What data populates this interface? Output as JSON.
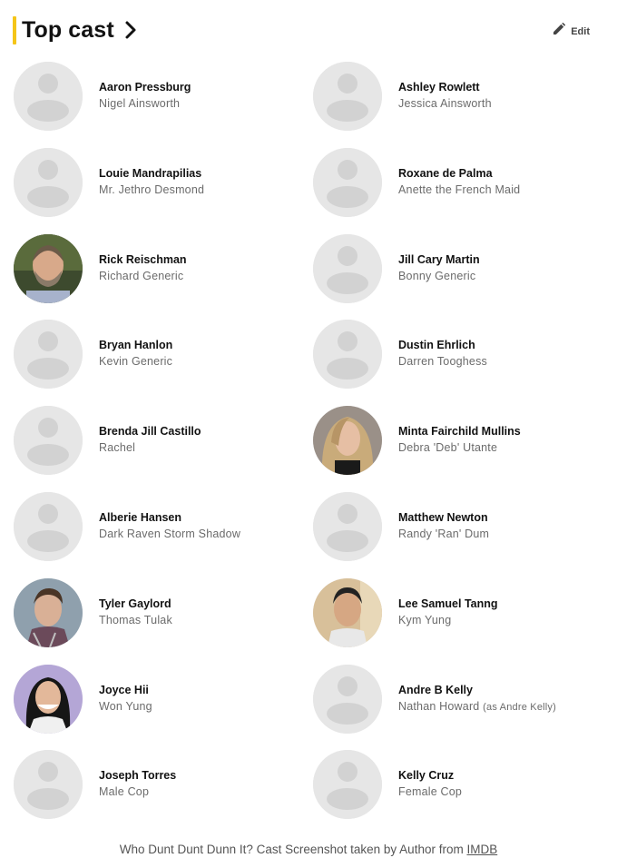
{
  "header": {
    "title": "Top cast",
    "edit_label": "Edit",
    "accent_color": "#f5c518"
  },
  "cast": [
    {
      "actor": "Aaron Pressburg",
      "role": "Nigel Ainsworth",
      "role_note": "",
      "photo": "placeholder"
    },
    {
      "actor": "Ashley Rowlett",
      "role": "Jessica Ainsworth",
      "role_note": "",
      "photo": "placeholder"
    },
    {
      "actor": "Louie Mandrapilias",
      "role": "Mr. Jethro Desmond",
      "role_note": "",
      "photo": "placeholder"
    },
    {
      "actor": "Roxane de Palma",
      "role": "Anette the French Maid",
      "role_note": "",
      "photo": "placeholder"
    },
    {
      "actor": "Rick Reischman",
      "role": "Richard Generic",
      "role_note": "",
      "photo": "man-beard"
    },
    {
      "actor": "Jill Cary Martin",
      "role": "Bonny Generic",
      "role_note": "",
      "photo": "placeholder"
    },
    {
      "actor": "Bryan Hanlon",
      "role": "Kevin Generic",
      "role_note": "",
      "photo": "placeholder"
    },
    {
      "actor": "Dustin Ehrlich",
      "role": "Darren Tooghess",
      "role_note": "",
      "photo": "placeholder"
    },
    {
      "actor": "Brenda Jill Castillo",
      "role": "Rachel",
      "role_note": "",
      "photo": "placeholder"
    },
    {
      "actor": "Minta Fairchild Mullins",
      "role": "Debra 'Deb' Utante",
      "role_note": "",
      "photo": "woman-blonde"
    },
    {
      "actor": "Alberie Hansen",
      "role": "Dark Raven Storm Shadow",
      "role_note": "",
      "photo": "placeholder"
    },
    {
      "actor": "Matthew Newton",
      "role": "Randy 'Ran' Dum",
      "role_note": "",
      "photo": "placeholder"
    },
    {
      "actor": "Tyler Gaylord",
      "role": "Thomas Tulak",
      "role_note": "",
      "photo": "man-young"
    },
    {
      "actor": "Lee Samuel Tanng",
      "role": "Kym Yung",
      "role_note": "",
      "photo": "man-asian"
    },
    {
      "actor": "Joyce Hii",
      "role": "Won Yung",
      "role_note": "",
      "photo": "woman-asian"
    },
    {
      "actor": "Andre B Kelly",
      "role": "Nathan Howard",
      "role_note": "(as Andre Kelly)",
      "photo": "placeholder"
    },
    {
      "actor": "Joseph Torres",
      "role": "Male Cop",
      "role_note": "",
      "photo": "placeholder"
    },
    {
      "actor": "Kelly Cruz",
      "role": "Female Cop",
      "role_note": "",
      "photo": "placeholder"
    }
  ],
  "caption": {
    "text": "Who Dunt Dunt Dunn It? Cast Screenshot taken by Author from ",
    "link": "IMDB"
  }
}
